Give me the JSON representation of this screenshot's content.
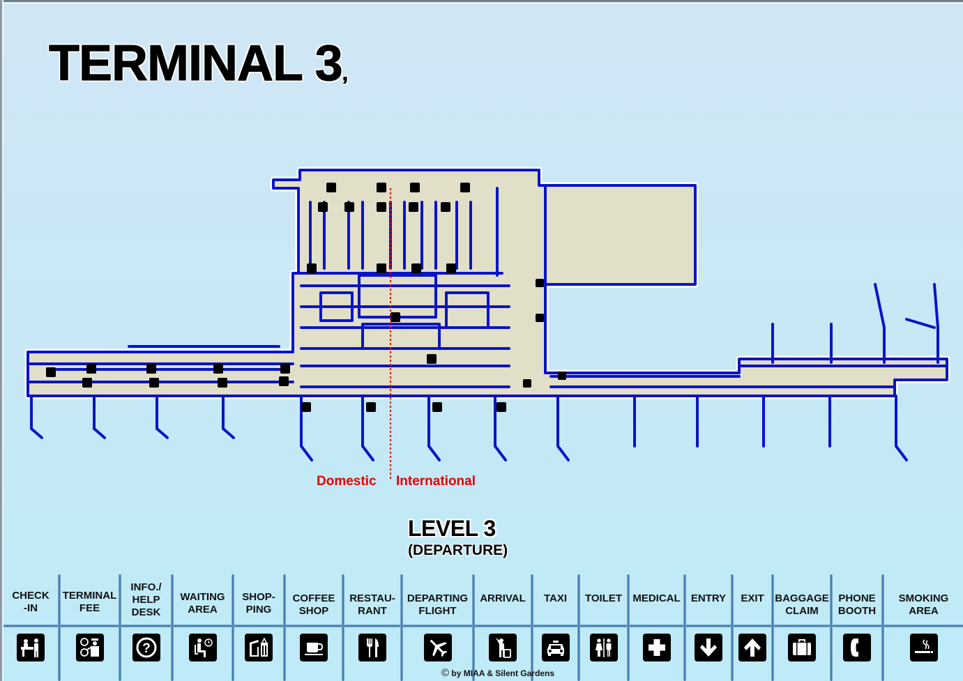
{
  "title": "TERMINAL 3",
  "title_suffix": ",",
  "level": {
    "title": "LEVEL 3",
    "subtitle": "(DEPARTURE)"
  },
  "zones": {
    "domestic": "Domestic",
    "international": "International"
  },
  "colors": {
    "wall": "#0a14c8",
    "floor": "#e1dfc8",
    "divider": "#e50000",
    "background": "#c8e8f5"
  },
  "legend": [
    {
      "label": "CHECK\n-IN",
      "icon": "check-in-icon"
    },
    {
      "label": "TERMINAL\nFEE",
      "icon": "terminal-fee-icon"
    },
    {
      "label": "INFO./\nHELP\nDESK",
      "icon": "info-help-desk-icon"
    },
    {
      "label": "WAITING\nAREA",
      "icon": "waiting-area-icon"
    },
    {
      "label": "SHOP-\nPING",
      "icon": "shopping-icon"
    },
    {
      "label": "COFFEE\nSHOP",
      "icon": "coffee-shop-icon"
    },
    {
      "label": "RESTAU-\nRANT",
      "icon": "restaurant-icon"
    },
    {
      "label": "DEPARTING\nFLIGHT",
      "icon": "departing-flight-icon"
    },
    {
      "label": "ARRIVAL",
      "icon": "arrival-icon"
    },
    {
      "label": "TAXI",
      "icon": "taxi-icon"
    },
    {
      "label": "TOILET",
      "icon": "toilet-icon"
    },
    {
      "label": "MEDICAL",
      "icon": "medical-icon"
    },
    {
      "label": "ENTRY",
      "icon": "entry-icon"
    },
    {
      "label": "EXIT",
      "icon": "exit-icon"
    },
    {
      "label": "BAGGAGE\nCLAIM",
      "icon": "baggage-claim-icon"
    },
    {
      "label": "PHONE\nBOOTH",
      "icon": "phone-booth-icon"
    },
    {
      "label": "SMOKING\nAREA",
      "icon": "smoking-area-icon"
    }
  ],
  "copyright": {
    "symbol": "©",
    "text": "by MIAA & Silent Gardens"
  }
}
